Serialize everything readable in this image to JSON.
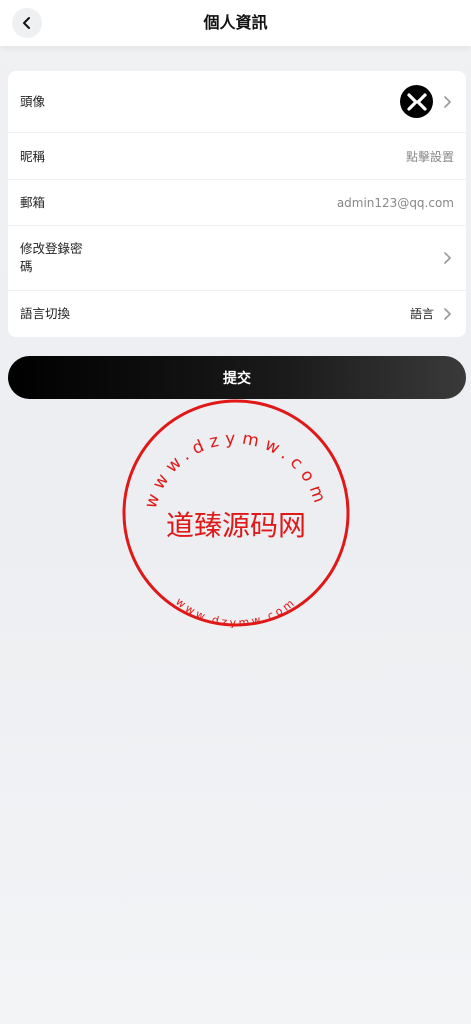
{
  "header": {
    "title": "個人資訊",
    "back_icon": "chevron-left-icon"
  },
  "profile": {
    "rows": [
      {
        "label": "頭像",
        "value": "",
        "has_chevron": true
      },
      {
        "label": "昵稱",
        "value": "點擊設置",
        "has_chevron": false
      },
      {
        "label": "郵箱",
        "value": "admin123@qq.com",
        "has_chevron": false
      },
      {
        "label_line1": "修改登錄密",
        "label_line2": "碼",
        "has_chevron": true
      },
      {
        "label": "語言切換",
        "value": "語言",
        "has_chevron": true
      }
    ]
  },
  "submit_label": "提交",
  "watermark": {
    "center_text": "道臻源码网",
    "ring_text_top": "www.dzymw.com",
    "ring_text_bottom": "www.dzymw.com",
    "color": "#e01818"
  },
  "colors": {
    "button_bg": "#000000",
    "card_bg": "#ffffff",
    "page_bg": "#eff0f2"
  }
}
